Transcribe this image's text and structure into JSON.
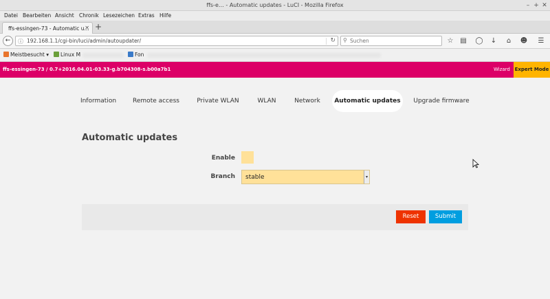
{
  "window": {
    "title": "ffs-e… - Automatic updates - LuCI - Mozilla Firefox",
    "controls": [
      "–",
      "+",
      "✕"
    ]
  },
  "menubar": [
    "Datei",
    "Bearbeiten",
    "Ansicht",
    "Chronik",
    "Lesezeichen",
    "Extras",
    "Hilfe"
  ],
  "tab": {
    "label": "ffs-essingen-73 - Automatic u...",
    "close": "✕",
    "new_tab": "+"
  },
  "navbar": {
    "url": "192.168.1.1/cgi-bin/luci/admin/autoupdater/",
    "search_placeholder": "Suchen"
  },
  "bookmarks": {
    "most_visited": "Meistbesucht",
    "linux": "Linux M",
    "fon": "Fon"
  },
  "luci": {
    "hostname": "ffs-essingen-73 / 0.7+2016.04.01-03.33-g.b704308-s.b00a7b1",
    "wizard": "Wizard",
    "expert_mode": "Expert Mode",
    "accent_color": "#dc0067",
    "expert_color": "#ffb400"
  },
  "nav_tabs": [
    {
      "label": "Information",
      "active": false
    },
    {
      "label": "Remote access",
      "active": false
    },
    {
      "label": "Private WLAN",
      "active": false
    },
    {
      "label": "WLAN",
      "active": false
    },
    {
      "label": "Network",
      "active": false
    },
    {
      "label": "Automatic updates",
      "active": true
    },
    {
      "label": "Upgrade firmware",
      "active": false
    }
  ],
  "page": {
    "title": "Automatic updates",
    "enable_label": "Enable",
    "enable_checked": false,
    "branch_label": "Branch",
    "branch_value": "stable",
    "branch_options": [
      "stable"
    ]
  },
  "actions": {
    "reset": "Reset",
    "submit": "Submit"
  }
}
